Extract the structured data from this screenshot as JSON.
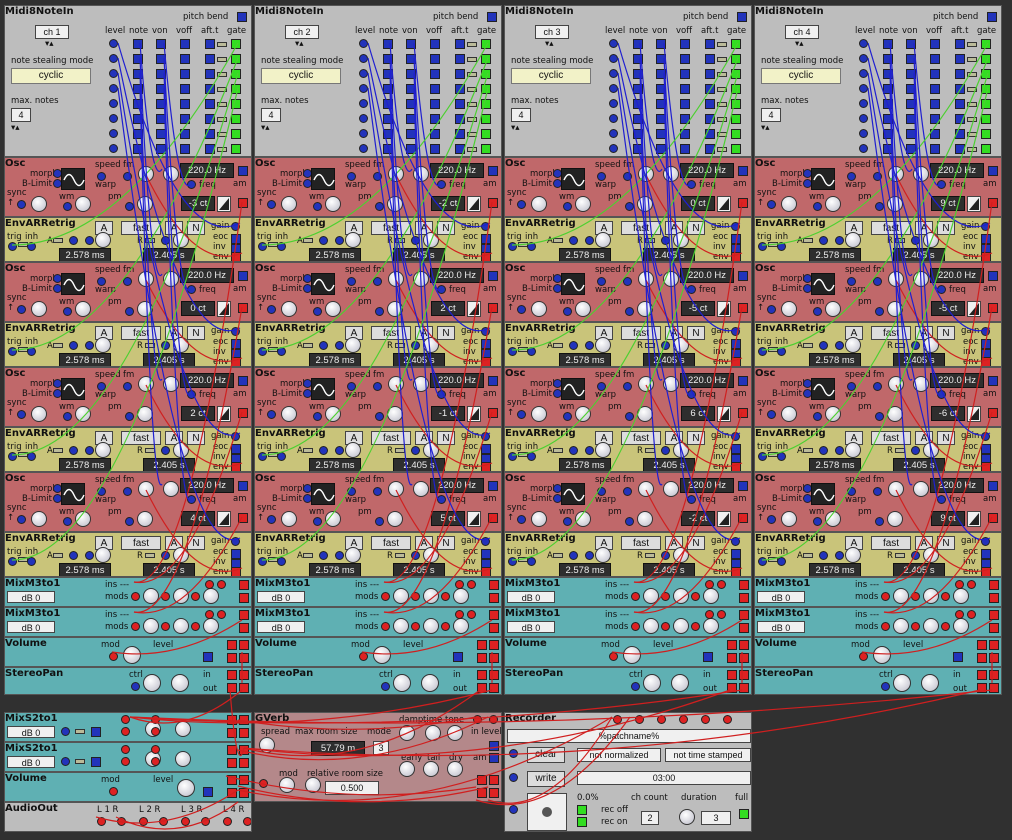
{
  "colors": {
    "midi": "#bdbdbd",
    "osc": "#c0686a",
    "env": "#c9c47a",
    "mix": "#5fb0b3",
    "input_jack": "#2233bb",
    "output_jack": "#dd2222",
    "gate": "#33dd22",
    "cable_blue": "#1f1fd0",
    "cable_green": "#4cd030",
    "cable_red": "#d01f1f"
  },
  "midi": {
    "title": "Midi8NoteIn",
    "pitch_bend": "pitch bend",
    "note_stealing_label": "note stealing mode",
    "mode_value": "cyclic",
    "max_notes_label": "max. notes",
    "max_notes_value": "4",
    "columns": [
      "level",
      "note",
      "von",
      "voff",
      "aft.t",
      "gate"
    ],
    "channels": [
      "ch 1",
      "ch 2",
      "ch 3",
      "ch 4"
    ]
  },
  "osc": {
    "title": "Osc",
    "morph": "morph",
    "blimit": "B-Limit",
    "sync": "sync",
    "wm": "wm",
    "pm": "pm",
    "speed": "speed",
    "fm": "fm",
    "warp": "warp",
    "freq_label": "freq",
    "am": "am",
    "freq_value": "220.0 Hz",
    "cents": [
      [
        "-3 ct",
        "-2 ct",
        "0 ct",
        "9 ct"
      ],
      [
        "0 ct",
        "2 ct",
        "-5 ct",
        "-5 ct"
      ],
      [
        "2 ct",
        "-1 ct",
        "6 ct",
        "-6 ct"
      ],
      [
        "4 ct",
        "5 ct",
        "-2 ct",
        "9 ct"
      ]
    ]
  },
  "env": {
    "title": "EnvARRetrig",
    "a_btn": "A",
    "fast": "fast",
    "n_btn": "N",
    "trig": "trig",
    "inh": "inh",
    "a": "A",
    "r": "R",
    "gain": "gain",
    "eoc": "eoc",
    "inv": "inv",
    "env": "env",
    "attack": "2.578 ms",
    "release": "2.405 s"
  },
  "mix": {
    "title": "MixM3to1",
    "ins": "ins ---",
    "mods": "mods",
    "db": "dB 0"
  },
  "volume": {
    "title": "Volume",
    "mod": "mod",
    "level": "level"
  },
  "pan": {
    "title": "StereoPan",
    "ctrl": "ctrl",
    "in": "in",
    "out": "out"
  },
  "mix2": {
    "title": "MixS2to1",
    "db": "dB 0"
  },
  "gverb": {
    "title": "GVerb",
    "spread": "spread",
    "max_room": "max room size",
    "mode": "mode",
    "room_value": "57.79 m",
    "mode_value": "3",
    "mod": "mod",
    "rel_room": "relative room size",
    "rel_value": "0.500",
    "damp": "damp",
    "time": "time",
    "tone": "tone",
    "in_level": "in level",
    "early": "early",
    "tail": "tail",
    "dry": "dry",
    "am": "am"
  },
  "recorder": {
    "title": "Recorder",
    "patchname": "%patchname%",
    "clear": "clear",
    "write": "write",
    "not_normalized": "not normalized",
    "not_time_stamped": "not time stamped",
    "time": "03:00",
    "percent": "0.0%",
    "rec_off": "rec off",
    "rec_on": "rec on",
    "ch_count": "ch count",
    "duration": "duration",
    "full": "full",
    "ch_value": "2",
    "dur_value": "3"
  },
  "audioout": {
    "title": "AudioOut",
    "channels": [
      "L 1 R",
      "L 2 R",
      "L 3 R",
      "L 4 R"
    ]
  }
}
